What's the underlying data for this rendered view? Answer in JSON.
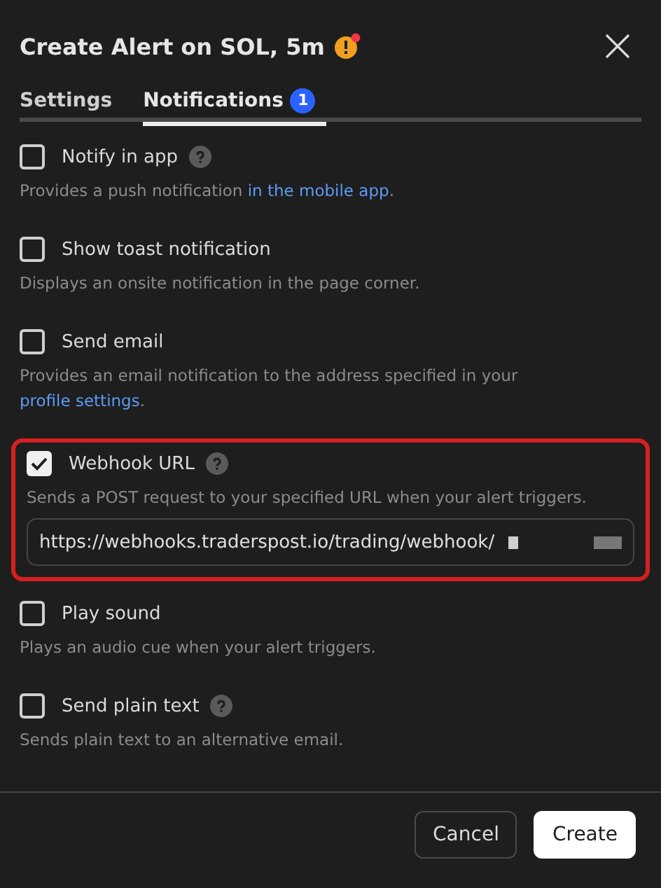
{
  "title": "Create Alert on SOL, 5m",
  "warning": true,
  "tabs": [
    {
      "label": "Settings",
      "selected": false
    },
    {
      "label": "Notifications",
      "selected": true,
      "badge": "1"
    }
  ],
  "options": [
    {
      "label": "Notify in app",
      "checked": false,
      "help": true,
      "highlighted": false,
      "description": "Provides a push notification ",
      "link": "in the mobile app",
      "after": "."
    },
    {
      "label": "Show toast notification",
      "checked": false,
      "help": false,
      "highlighted": false,
      "description": "Displays an onsite notification in the page corner."
    },
    {
      "label": "Send email",
      "checked": false,
      "help": false,
      "highlighted": false,
      "description": "Provides an email notification to the address specified in your ",
      "link": "profile settings",
      "after": "."
    },
    {
      "label": "Webhook URL",
      "checked": true,
      "help": true,
      "highlighted": true,
      "description": "Sends a POST request to your specified URL when your alert triggers.",
      "field": "https://webhooks.traderspost.io/trading/webhook/"
    },
    {
      "label": "Play sound",
      "checked": false,
      "help": false,
      "highlighted": false,
      "description": "Plays an audio cue when your alert triggers."
    },
    {
      "label": "Send plain text",
      "checked": false,
      "help": true,
      "highlighted": false,
      "description": "Sends plain text to an alternative email."
    }
  ],
  "buttons": [
    {
      "label": "Cancel",
      "kind": "secondary"
    },
    {
      "label": "Create",
      "kind": "primary"
    }
  ]
}
